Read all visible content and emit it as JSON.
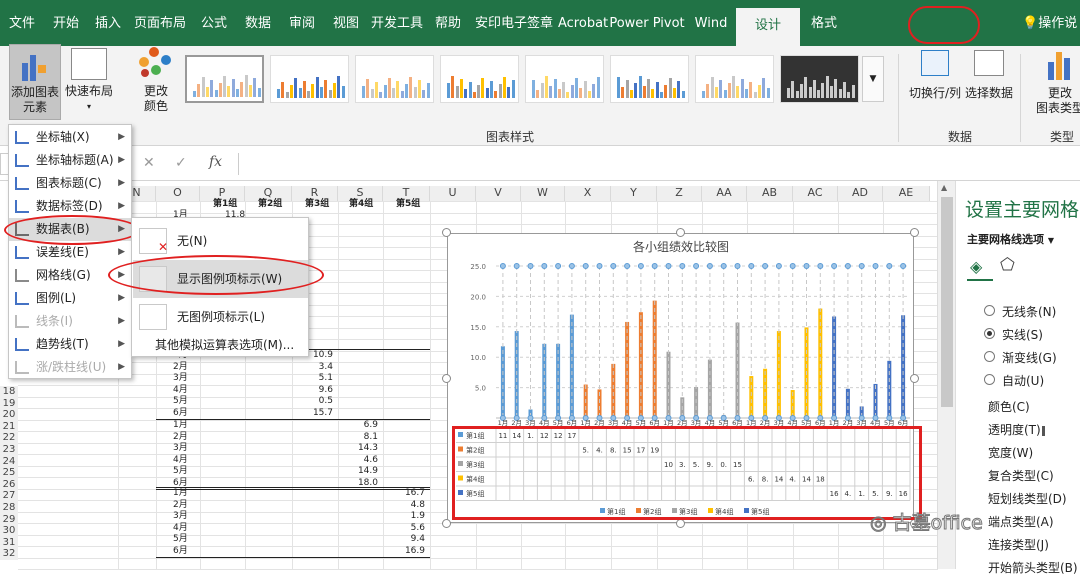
{
  "tabs": [
    "文件",
    "开始",
    "插入",
    "页面布局",
    "公式",
    "数据",
    "审阅",
    "视图",
    "开发工具",
    "帮助",
    "安印电子签章",
    "Acrobat",
    "Power Pivot",
    "Wind",
    "设计",
    "格式"
  ],
  "tell_me": "操作说",
  "ribbon": {
    "add_element": [
      "添加图表",
      "元素"
    ],
    "quick_layout": "快速布局",
    "change_colors": [
      "更改",
      "颜色"
    ],
    "styles_group": "图表样式",
    "switch_rowcol": "切换行/列",
    "select_data": "选择数据",
    "data_group": "数据",
    "change_type": [
      "更改",
      "图表类型"
    ],
    "type_group": "类型"
  },
  "formula": {
    "cancel": "✕",
    "enter": "✓",
    "fx": "fx",
    "name_box": ""
  },
  "columns": [
    "N",
    "O",
    "P",
    "Q",
    "R",
    "S",
    "T",
    "U",
    "V",
    "W",
    "X",
    "Y",
    "Z",
    "AA",
    "AB",
    "AC",
    "AD",
    "AE"
  ],
  "rows": [
    "18",
    "19",
    "20",
    "21",
    "22",
    "23",
    "24",
    "25",
    "26",
    "27",
    "28",
    "29",
    "30",
    "31",
    "32"
  ],
  "sheet": {
    "headers": [
      "第1组",
      "第2组",
      "第3组",
      "第4组",
      "第5组"
    ],
    "top": {
      "month": "1月",
      "value": "11.8"
    },
    "g3": [
      [
        "1月",
        "10.9"
      ],
      [
        "2月",
        "3.4"
      ],
      [
        "3月",
        "5.1"
      ],
      [
        "4月",
        "9.6"
      ],
      [
        "5月",
        "0.5"
      ],
      [
        "6月",
        "15.7"
      ]
    ],
    "g4": [
      [
        "1月",
        "6.9"
      ],
      [
        "2月",
        "8.1"
      ],
      [
        "3月",
        "14.3"
      ],
      [
        "4月",
        "4.6"
      ],
      [
        "5月",
        "14.9"
      ],
      [
        "6月",
        "18.0"
      ]
    ],
    "g5": [
      [
        "1月",
        "16.7"
      ],
      [
        "2月",
        "4.8"
      ],
      [
        "3月",
        "1.9"
      ],
      [
        "4月",
        "5.6"
      ],
      [
        "5月",
        "9.4"
      ],
      [
        "6月",
        "16.9"
      ]
    ]
  },
  "menu": [
    {
      "label": "坐标轴(X)",
      "disabled": false
    },
    {
      "label": "坐标轴标题(A)",
      "disabled": false
    },
    {
      "label": "图表标题(C)",
      "disabled": false
    },
    {
      "label": "数据标签(D)",
      "disabled": false
    },
    {
      "label": "数据表(B)",
      "disabled": false
    },
    {
      "label": "误差线(E)",
      "disabled": false
    },
    {
      "label": "网格线(G)",
      "disabled": false
    },
    {
      "label": "图例(L)",
      "disabled": false
    },
    {
      "label": "线条(I)",
      "disabled": true
    },
    {
      "label": "趋势线(T)",
      "disabled": false
    },
    {
      "label": "涨/跌柱线(U)",
      "disabled": true
    }
  ],
  "submenu": {
    "none": "无(N)",
    "with_keys": "显示图例项标示(W)",
    "no_keys": "无图例项标示(L)",
    "more": "其他模拟运算表选项(M)..."
  },
  "chart_data": {
    "type": "bar",
    "title": "各小组绩效比较图",
    "ylim": [
      0,
      25
    ],
    "yticks": [
      "25.0",
      "20.0",
      "15.0",
      "10.0",
      "5.0"
    ],
    "month_labels": [
      "1月",
      "2月",
      "3月",
      "4月",
      "5月",
      "6月"
    ],
    "colors": [
      "#5b9bd5",
      "#ed7d31",
      "#a5a5a5",
      "#ffc000",
      "#4472c4"
    ],
    "series": [
      {
        "name": "第1组",
        "values": [
          11.8,
          14.3,
          1.4,
          12.2,
          12.2,
          17.0
        ]
      },
      {
        "name": "第2组",
        "values": [
          5.5,
          4.7,
          8.9,
          15.8,
          17.4,
          19.3
        ]
      },
      {
        "name": "第3组",
        "values": [
          10.9,
          3.4,
          5.1,
          9.6,
          0.5,
          15.7
        ]
      },
      {
        "name": "第4组",
        "values": [
          6.9,
          8.1,
          14.3,
          4.6,
          14.9,
          18.0
        ]
      },
      {
        "name": "第5组",
        "values": [
          16.7,
          4.8,
          1.9,
          5.6,
          9.4,
          16.9
        ]
      }
    ],
    "table_rows": [
      {
        "name": "第1组",
        "values": [
          "11",
          "14",
          "1.",
          "12",
          "12",
          "17"
        ]
      },
      {
        "name": "第2组",
        "values": [
          "5.",
          "4.",
          "8.",
          "15",
          "17",
          "19"
        ]
      },
      {
        "name": "第3组",
        "values": [
          "10",
          "3.",
          "5.",
          "9.",
          "0.",
          "15"
        ]
      },
      {
        "name": "第4组",
        "values": [
          "6.",
          "8.",
          "14",
          "4.",
          "14",
          "18"
        ]
      },
      {
        "name": "第5组",
        "values": [
          "16",
          "4.",
          "1.",
          "5.",
          "9.",
          "16"
        ]
      }
    ],
    "legend": [
      "第1组",
      "第2组",
      "第3组",
      "第4组",
      "第5组"
    ]
  },
  "pane": {
    "title": "设置主要网格",
    "dropdown": "主要网格线选项",
    "line_options": [
      "无线条(N)",
      "实线(S)",
      "渐变线(G)",
      "自动(U)"
    ],
    "selected": "实线(S)",
    "props": [
      "颜色(C)",
      "透明度(T)",
      "宽度(W)",
      "复合类型(C)",
      "短划线类型(D)",
      "端点类型(A)",
      "连接类型(J)",
      "开始箭头类型(B)"
    ]
  },
  "watermark": "古墓office"
}
